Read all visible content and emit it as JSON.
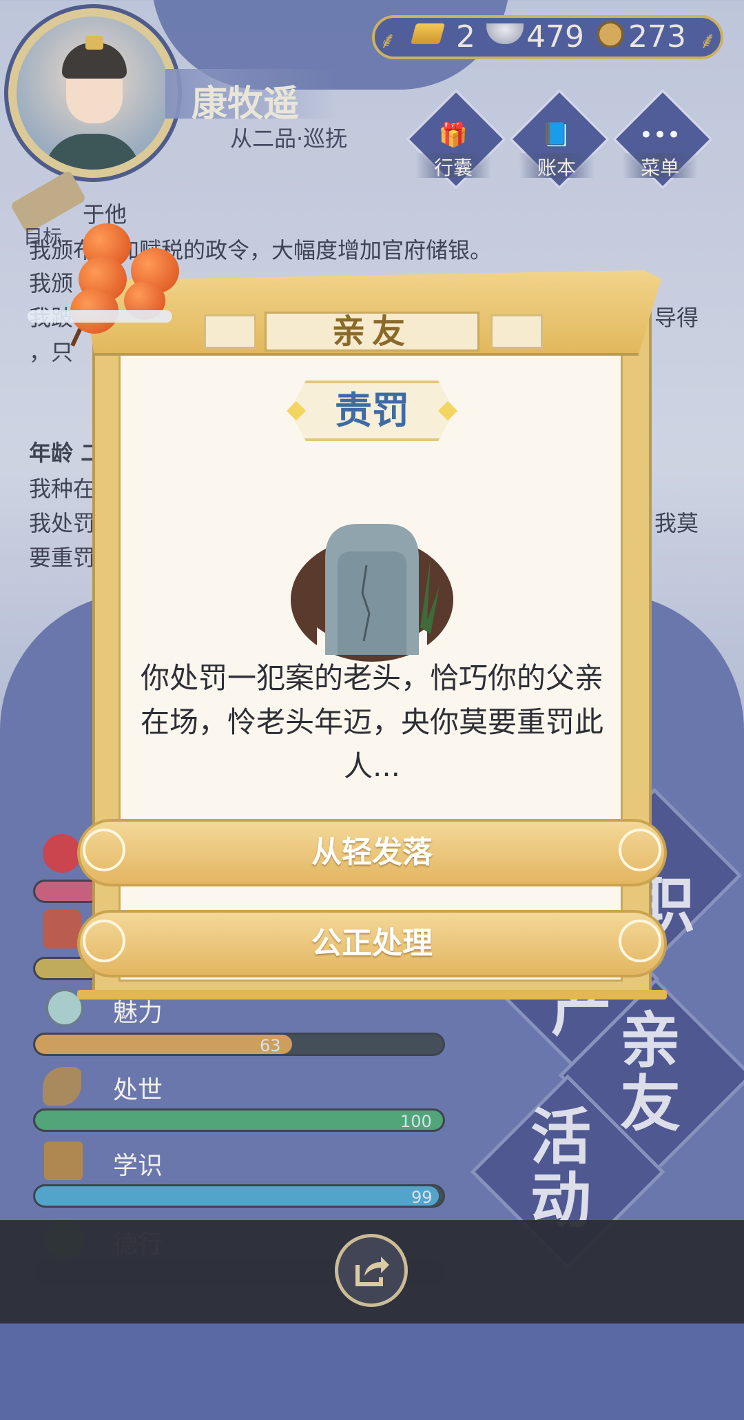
{
  "player": {
    "name": "康牧遥",
    "rank": "从二品·巡抚"
  },
  "currency": {
    "gold": "2",
    "silver": "479",
    "coins": "273"
  },
  "top_menu": [
    {
      "label": "行囊",
      "icon": "bag-icon"
    },
    {
      "label": "账本",
      "icon": "ledger-icon"
    },
    {
      "label": "菜单",
      "icon": "more-icon"
    }
  ],
  "goal": {
    "label": "目标",
    "partial_text": "于他"
  },
  "background_text": [
    "我颁布增加赋税的政令，大幅度增加官府储银。",
    "我颁",
    "我跛",
    "，只",
    "年龄 二",
    "我种在",
    "我处罚",
    "要重罚"
  ],
  "background_text_right": [
    "导得",
    "我莫"
  ],
  "stats": [
    {
      "name": "魅力",
      "value": "63",
      "fraction": 0.63,
      "color": "#c9934a"
    },
    {
      "name": "处世",
      "value": "100",
      "fraction": 1.0,
      "color": "#3f9a6a"
    },
    {
      "name": "学识",
      "value": "99",
      "fraction": 0.99,
      "color": "#3f9ac4"
    },
    {
      "name": "德行",
      "value": "",
      "fraction": 0.0,
      "color": "#7a5aa0"
    }
  ],
  "side_buttons": {
    "relatives": "亲友",
    "activity": "活动",
    "partial_top": "职",
    "partial_left": "产"
  },
  "dialog": {
    "title": "亲友",
    "event_tag": "责罚",
    "event_text": "你处罚一犯案的老头，恰巧你的父亲在场，怜老头年迈，央你莫要重罚此人...",
    "choices": [
      "从轻发落",
      "公正处理"
    ]
  },
  "colors": {
    "dialog_gold": "#e7c77a",
    "tag_blue": "#3e6aa6",
    "panel_blue": "#3b4684"
  }
}
